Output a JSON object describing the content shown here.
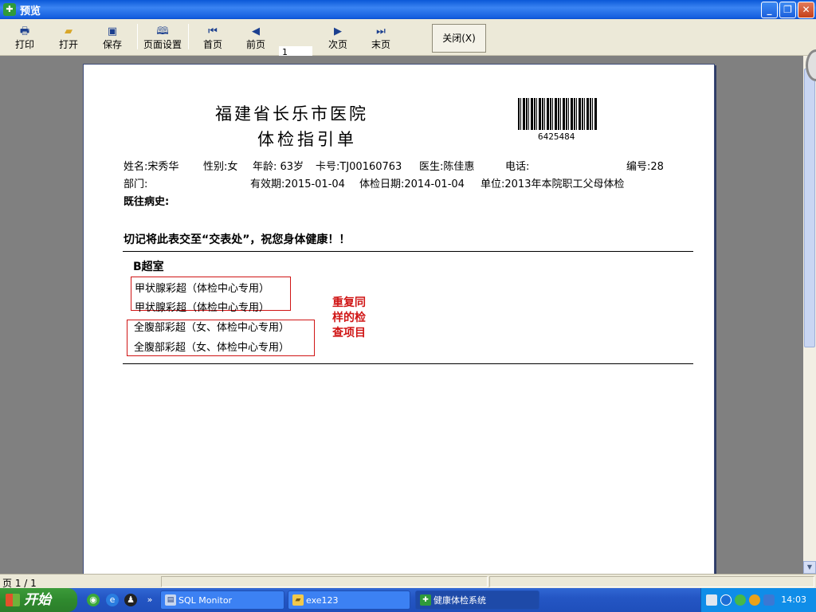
{
  "window": {
    "title": "预览"
  },
  "toolbar": {
    "print": "打印",
    "open": "打开",
    "save": "保存",
    "page_setup": "页面设置",
    "first": "首页",
    "prev": "前页",
    "page_value": "1",
    "next": "次页",
    "last": "末页",
    "close": "关闭(X)"
  },
  "document": {
    "hospital": "福建省长乐市医院",
    "form_title": "体检指引单",
    "barcode_number": "6425484",
    "name": "姓名:宋秀华",
    "gender": "性别:女",
    "age": "年龄: 63岁",
    "card_no": "卡号:TJ00160763",
    "doctor": "医生:陈佳惠",
    "phone": "电话:",
    "serial": "编号:28",
    "department": "部门:",
    "valid_date": "有效期:2015-01-04",
    "exam_date": "体检日期:2014-01-04",
    "unit": "单位:2013年本院职工父母体检",
    "history": "既往病史:",
    "reminder": "切记将此表交至“交表处”，祝您身体健康！！",
    "section": "B超室",
    "items": [
      "甲状腺彩超（体检中心专用）",
      "甲状腺彩超（体检中心专用）",
      "全腹部彩超（女、体检中心专用）",
      "全腹部彩超（女、体检中心专用）"
    ],
    "annotation": "重复同样的检查项目"
  },
  "statusbar": {
    "page": "页 1 / 1"
  },
  "taskbar": {
    "start": "开始",
    "tasks": [
      "SQL Monitor",
      "exe123",
      "健康体检系统"
    ],
    "clock": "14:03"
  },
  "colors": {
    "annotation_red": "#d01515",
    "titlebar_blue": "#0a58d8",
    "workspace_gray": "#808080"
  }
}
